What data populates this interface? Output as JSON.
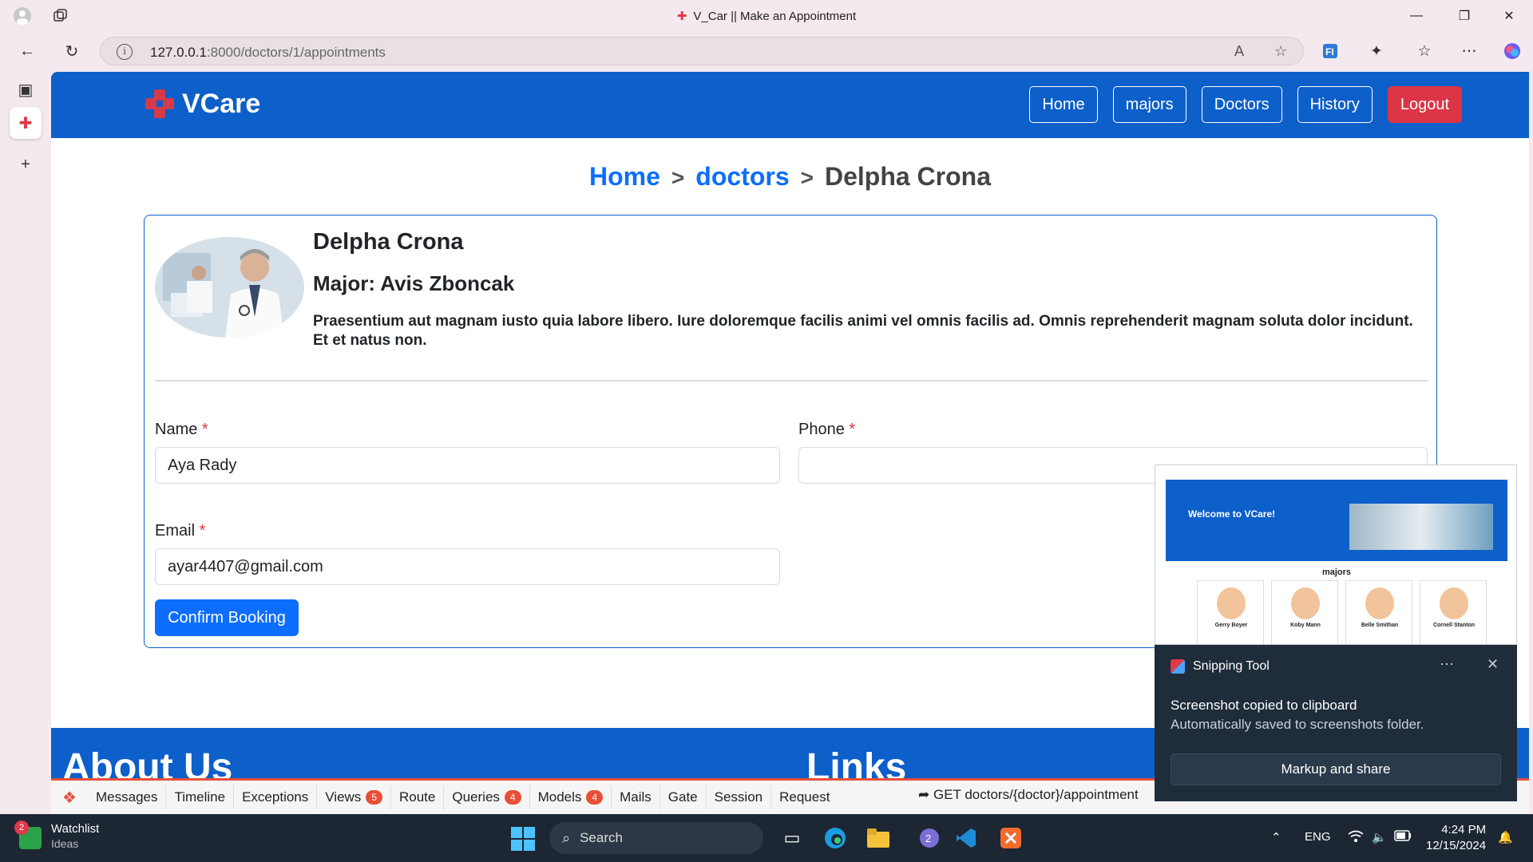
{
  "browser": {
    "window_title": "V_Car || Make an Appointment",
    "url_host": "127.0.0.1",
    "url_rest": ":8000/doctors/1/appointments"
  },
  "site": {
    "brand": "VCare",
    "nav": [
      "Home",
      "majors",
      "Doctors",
      "History"
    ],
    "logout": "Logout",
    "colors": {
      "primary": "#0d5fc9",
      "danger": "#dc3545",
      "button": "#0d6efd"
    }
  },
  "breadcrumb": {
    "home": "Home",
    "sep": ">",
    "doctors": "doctors",
    "current": "Delpha Crona"
  },
  "doctor": {
    "name": "Delpha Crona",
    "major": "Major: Avis Zboncak",
    "description": "Praesentium aut magnam iusto quia labore libero. Iure doloremque facilis animi vel omnis facilis ad. Omnis reprehenderit magnam soluta dolor incidunt. Et et natus non."
  },
  "form": {
    "name_label": "Name",
    "name_value": "Aya Rady",
    "phone_label": "Phone",
    "phone_value": "",
    "email_label": "Email",
    "email_value": "ayar4407@gmail.com",
    "required_mark": "*",
    "submit": "Confirm Booking"
  },
  "footer": {
    "about": "About Us",
    "links": "Links"
  },
  "debugbar": {
    "tabs": [
      {
        "label": "Messages"
      },
      {
        "label": "Timeline"
      },
      {
        "label": "Exceptions"
      },
      {
        "label": "Views",
        "badge": "5"
      },
      {
        "label": "Route"
      },
      {
        "label": "Queries",
        "badge": "4"
      },
      {
        "label": "Models",
        "badge": "4"
      },
      {
        "label": "Mails"
      },
      {
        "label": "Gate"
      },
      {
        "label": "Session"
      },
      {
        "label": "Request"
      }
    ],
    "route": "GET doctors/{doctor}/appointment"
  },
  "snip_thumbnail": {
    "hero_title": "Welcome to VCare!",
    "majors_heading": "majors",
    "cards": [
      "Gerry Boyer",
      "Koby Mann",
      "Belle Smithan",
      "Cornell Stanton"
    ]
  },
  "snipping_tool": {
    "app": "Snipping Tool",
    "line1": "Screenshot copied to clipboard",
    "line2": "Automatically saved to screenshots folder.",
    "action": "Markup and share"
  },
  "taskbar": {
    "widget_title": "Watchlist",
    "widget_sub": "Ideas",
    "widget_badge": "2",
    "search": "Search",
    "teams_badge": "2",
    "lang": "ENG",
    "time": "4:24 PM",
    "date": "12/15/2024"
  }
}
